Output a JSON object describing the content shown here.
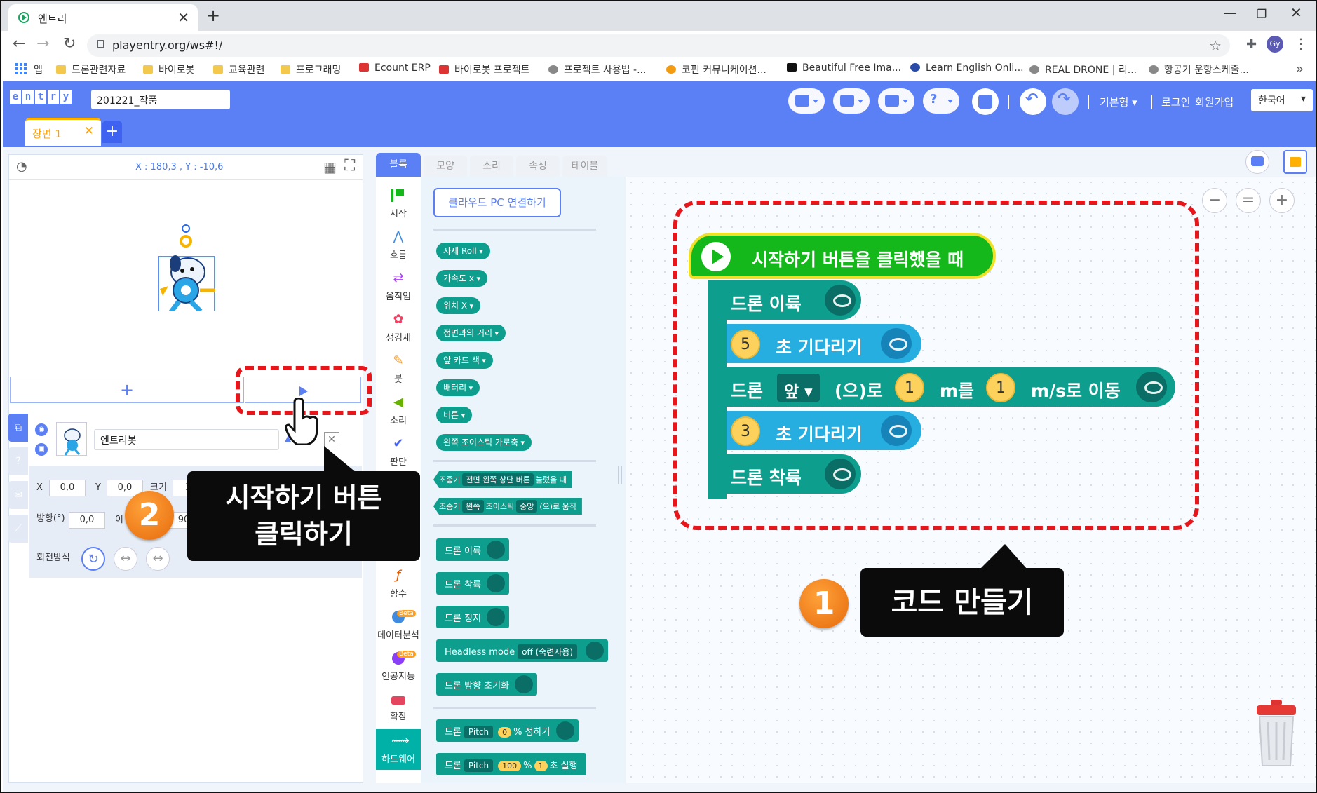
{
  "browser": {
    "tab_title": "엔트리",
    "url": "playentry.org/ws#!/",
    "profile_initials": "Gy",
    "bookmarks": [
      "앱",
      "드론관련자료",
      "바이로봇",
      "교육관련",
      "프로그래밍",
      "Ecount ERP",
      "바이로봇 프로젝트",
      "프로젝트 사용법 -...",
      "코핀 커뮤니케이션...",
      "Beautiful Free Ima...",
      "Learn English Onli...",
      "REAL DRONE | 리...",
      "항공기 운항스케줄..."
    ]
  },
  "header": {
    "logo_letters": [
      "e",
      "n",
      "t",
      "r",
      "y"
    ],
    "project_name": "201221_작품",
    "mode_label": "기본형",
    "login_label": "로그인",
    "signup_label": "회원가입",
    "language": "한국어",
    "accent_color": "#5b7ff5"
  },
  "scene": {
    "tab_label": "장면 1",
    "add_label": "+"
  },
  "stage": {
    "coord_readout": "X : 180,3 , Y : -10,6",
    "add_object_label": "+"
  },
  "object": {
    "name": "엔트리봇",
    "x_label": "X",
    "x_value": "0,0",
    "y_label": "Y",
    "y_value": "0,0",
    "size_label": "크기",
    "size_value": "10",
    "direction_label": "방향(°)",
    "direction_value": "0,0",
    "move_dir_label": "이",
    "move_dir_value": "90",
    "rotation_label": "회전방식"
  },
  "palette": {
    "tabs": [
      "블록",
      "모양",
      "소리",
      "속성",
      "테이블"
    ],
    "categories": [
      "시작",
      "흐름",
      "움직임",
      "생김새",
      "붓",
      "소리",
      "판단",
      "함수",
      "데이터분석",
      "인공지능",
      "확장",
      "하드웨어"
    ],
    "beta_label": "Beta",
    "cloud_button": "클라우드 PC 연결하기",
    "value_blocks": [
      "자세 Roll",
      "가속도 x",
      "위치 X",
      "정면과의 거리",
      "앞 카드 색",
      "배터리",
      "버튼",
      "왼쪽 조이스틱 가로축"
    ],
    "cond_blocks": [
      [
        "조종기",
        "전면 왼쪽 상단 버튼",
        "눌렀을 때"
      ],
      [
        "조종기",
        "왼쪽",
        "조이스틱",
        "중앙",
        "(으)로 움직"
      ]
    ],
    "action_blocks": [
      "드론 이륙",
      "드론 착륙",
      "드론 정지"
    ],
    "headless": {
      "label": "Headless mode",
      "value": "off (숙련자용)"
    },
    "reset_dir": "드론 방향 초기화",
    "pitch_block": {
      "prefix": "드론",
      "dd": "Pitch",
      "num": "0",
      "suffix": "% 정하기"
    },
    "pitch_run": {
      "prefix": "드론",
      "dd": "Pitch",
      "num1": "100",
      "pct": "%",
      "num2": "1",
      "suffix": "초 실행"
    }
  },
  "code": {
    "hat": "시작하기 버튼을 클릭했을 때",
    "takeoff": "드론 이륙",
    "wait1_num": "5",
    "wait1_text": "초 기다리기",
    "move_prefix": "드론",
    "move_dir": "앞",
    "move_mid": "(으)로",
    "move_dist": "1",
    "move_unit1": "m를",
    "move_speed": "1",
    "move_unit2": "m/s로 이동",
    "wait2_num": "3",
    "wait2_text": "초 기다리기",
    "land": "드론 착륙"
  },
  "zoom": [
    "−",
    "=",
    "+"
  ],
  "annotations": {
    "badge1": "1",
    "callout1": "코드 만들기",
    "badge2": "2",
    "callout2_line1": "시작하기 버튼",
    "callout2_line2": "클릭하기"
  }
}
